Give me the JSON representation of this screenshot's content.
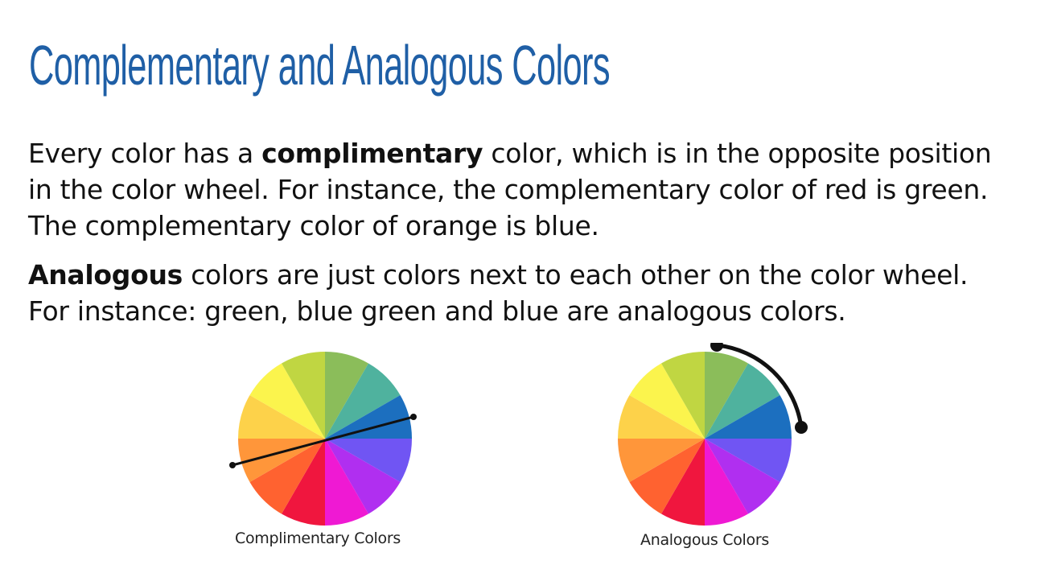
{
  "slide": {
    "title": "Complementary and Analogous Colors",
    "paragraph1": {
      "pre": "Every color has a ",
      "bold": "complimentary",
      "post": " color, which is in the opposite position in the color wheel. For instance, the complementary color of red is green. The complementary color of orange is blue."
    },
    "paragraph2": {
      "bold": "Analogous",
      "post": " colors are just colors next to each other on the color wheel. For instance: green, blue green and blue are analogous colors."
    },
    "colors": {
      "title": "#1f5fa6",
      "body_text": "#111111"
    }
  },
  "wheel_colors": [
    "#8bbd5a",
    "#4fb29e",
    "#1c6fbf",
    "#7055f3",
    "#b02ff0",
    "#ef19d3",
    "#f0163e",
    "#ff6230",
    "#ff963a",
    "#fdd24a",
    "#fbf44d",
    "#c0d642"
  ],
  "figures": {
    "left_caption": "Complimentary Colors",
    "right_caption": "Analogous Colors"
  }
}
